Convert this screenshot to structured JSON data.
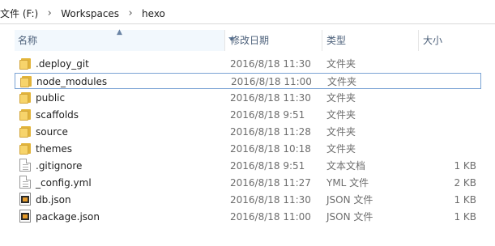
{
  "breadcrumb": {
    "drive": "文件 (F:)",
    "folder1": "Workspaces",
    "folder2": "hexo",
    "separator": "›"
  },
  "columns": {
    "name": "名称",
    "date": "修改日期",
    "type": "类型",
    "size": "大小"
  },
  "colors": {
    "header_text": "#4c607a",
    "folder": "#f7d46b",
    "focus_border": "#7aa3d4"
  },
  "files": [
    {
      "name": ".deploy_git",
      "date": "2016/8/18 11:30",
      "type": "文件夹",
      "size": "",
      "icon": "folder-icon"
    },
    {
      "name": "node_modules",
      "date": "2016/8/18 11:00",
      "type": "文件夹",
      "size": "",
      "icon": "folder-icon"
    },
    {
      "name": "public",
      "date": "2016/8/18 11:30",
      "type": "文件夹",
      "size": "",
      "icon": "folder-icon"
    },
    {
      "name": "scaffolds",
      "date": "2016/8/18 9:51",
      "type": "文件夹",
      "size": "",
      "icon": "folder-icon"
    },
    {
      "name": "source",
      "date": "2016/8/18 11:28",
      "type": "文件夹",
      "size": "",
      "icon": "folder-icon"
    },
    {
      "name": "themes",
      "date": "2016/8/18 10:18",
      "type": "文件夹",
      "size": "",
      "icon": "folder-icon"
    },
    {
      "name": ".gitignore",
      "date": "2016/8/18 9:51",
      "type": "文本文档",
      "size": "1 KB",
      "icon": "text-document-icon"
    },
    {
      "name": "_config.yml",
      "date": "2016/8/18 11:27",
      "type": "YML 文件",
      "size": "2 KB",
      "icon": "text-document-icon"
    },
    {
      "name": "db.json",
      "date": "2016/8/18 11:30",
      "type": "JSON 文件",
      "size": "1 KB",
      "icon": "json-file-icon"
    },
    {
      "name": "package.json",
      "date": "2016/8/18 11:00",
      "type": "JSON 文件",
      "size": "1 KB",
      "icon": "json-file-icon"
    }
  ]
}
